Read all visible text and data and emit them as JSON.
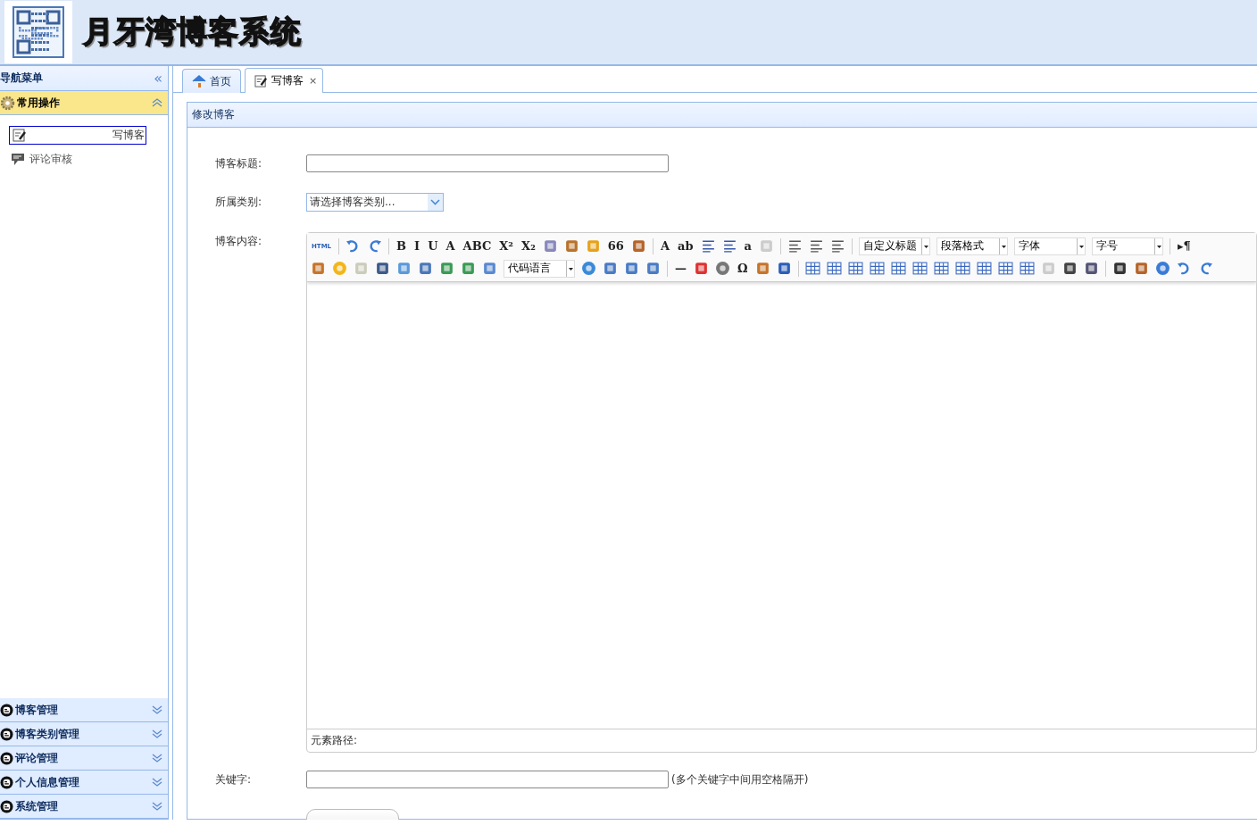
{
  "header": {
    "title": "月牙湾博客系统"
  },
  "sidebar": {
    "title": "导航菜单",
    "collapse": "«",
    "groups": [
      {
        "label": "常用操作",
        "expanded": true,
        "items": [
          {
            "label": "写博客",
            "selected": true
          },
          {
            "label": "评论审核",
            "selected": false
          }
        ]
      },
      {
        "label": "博客管理",
        "expanded": false
      },
      {
        "label": "博客类别管理",
        "expanded": false
      },
      {
        "label": "评论管理",
        "expanded": false
      },
      {
        "label": "个人信息管理",
        "expanded": false
      },
      {
        "label": "系统管理",
        "expanded": false
      }
    ]
  },
  "tabs": [
    {
      "label": "首页",
      "selected": false
    },
    {
      "label": "写博客",
      "selected": true,
      "close": "×"
    }
  ],
  "panel": {
    "title": "修改博客",
    "title_field": {
      "label": "博客标题:"
    },
    "category_field": {
      "label": "所属类别:",
      "value": "请选择博客类别..."
    },
    "content_label": "博客内容:",
    "editor": {
      "toolbar": [
        [
          {
            "kind": "glyph",
            "text": "HTML"
          },
          {
            "kind": "sep"
          },
          {
            "kind": "button"
          },
          {
            "kind": "button"
          },
          {
            "kind": "sep"
          },
          {
            "kind": "glyph",
            "text": "B"
          },
          {
            "kind": "glyph",
            "text": "I"
          },
          {
            "kind": "glyph",
            "text": "U"
          },
          {
            "kind": "glyph",
            "text": "A"
          },
          {
            "kind": "glyph",
            "text": "ABC"
          },
          {
            "kind": "glyph",
            "text": "X²"
          },
          {
            "kind": "glyph",
            "text": "X₂"
          },
          {
            "kind": "button"
          },
          {
            "kind": "button"
          },
          {
            "kind": "button"
          },
          {
            "kind": "glyph",
            "text": "66"
          },
          {
            "kind": "button"
          },
          {
            "kind": "sep"
          },
          {
            "kind": "glyph",
            "text": "A"
          },
          {
            "kind": "glyph",
            "text": "ab"
          },
          {
            "kind": "button"
          },
          {
            "kind": "button"
          },
          {
            "kind": "glyph",
            "text": "a"
          },
          {
            "kind": "button"
          },
          {
            "kind": "sep"
          },
          {
            "kind": "button"
          },
          {
            "kind": "button"
          },
          {
            "kind": "button"
          },
          {
            "kind": "sep"
          },
          {
            "kind": "dropdown",
            "text": "自定义标题"
          },
          {
            "kind": "dropdown",
            "text": "段落格式"
          },
          {
            "kind": "dropdown",
            "text": "字体"
          },
          {
            "kind": "dropdown",
            "text": "字号"
          },
          {
            "kind": "sep"
          },
          {
            "kind": "glyph",
            "text": "▸¶"
          }
        ],
        [
          {
            "kind": "button"
          },
          {
            "kind": "button"
          },
          {
            "kind": "button"
          },
          {
            "kind": "button"
          },
          {
            "kind": "button"
          },
          {
            "kind": "button"
          },
          {
            "kind": "button"
          },
          {
            "kind": "button"
          },
          {
            "kind": "button"
          },
          {
            "kind": "dropdown",
            "text": "代码语言"
          },
          {
            "kind": "button"
          },
          {
            "kind": "button"
          },
          {
            "kind": "button"
          },
          {
            "kind": "button"
          },
          {
            "kind": "sep"
          },
          {
            "kind": "glyph",
            "text": "—"
          },
          {
            "kind": "button"
          },
          {
            "kind": "button"
          },
          {
            "kind": "glyph",
            "text": "Ω"
          },
          {
            "kind": "button"
          },
          {
            "kind": "button"
          },
          {
            "kind": "sep"
          },
          {
            "kind": "button"
          },
          {
            "kind": "button"
          },
          {
            "kind": "button"
          },
          {
            "kind": "button"
          },
          {
            "kind": "button"
          },
          {
            "kind": "button"
          },
          {
            "kind": "button"
          },
          {
            "kind": "button"
          },
          {
            "kind": "button"
          },
          {
            "kind": "button"
          },
          {
            "kind": "button"
          },
          {
            "kind": "button"
          },
          {
            "kind": "button"
          },
          {
            "kind": "button"
          },
          {
            "kind": "sep"
          },
          {
            "kind": "button"
          },
          {
            "kind": "button"
          },
          {
            "kind": "button"
          },
          {
            "kind": "button"
          },
          {
            "kind": "button"
          }
        ]
      ],
      "path_label": "元素路径:"
    },
    "keywords_field": {
      "label": "关键字:",
      "hint": "(多个关键字中间用空格隔开)"
    }
  }
}
